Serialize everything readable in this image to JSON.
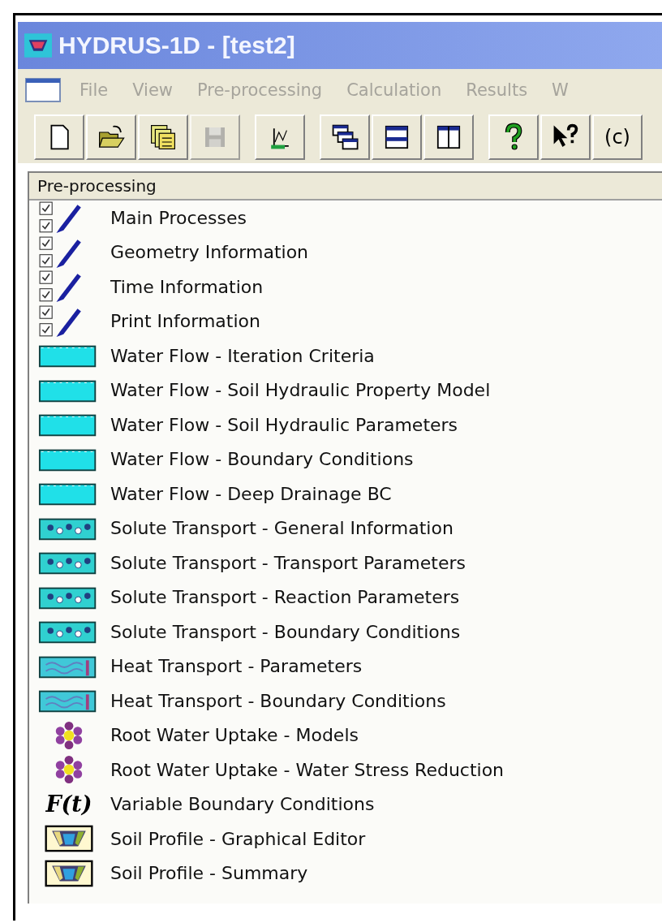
{
  "window": {
    "title": "HYDRUS-1D - [test2]"
  },
  "menu": [
    "File",
    "View",
    "Pre-processing",
    "Calculation",
    "Results",
    "W"
  ],
  "toolbar": [
    {
      "kind": "new",
      "disabled": false
    },
    {
      "kind": "open",
      "disabled": false
    },
    {
      "kind": "copy",
      "disabled": false
    },
    {
      "kind": "save",
      "disabled": true
    },
    {
      "kind": "graph",
      "disabled": false
    },
    {
      "kind": "cascade",
      "disabled": false
    },
    {
      "kind": "tile-horizontal",
      "disabled": false
    },
    {
      "kind": "tile-vertical",
      "disabled": false
    },
    {
      "kind": "help",
      "disabled": false
    },
    {
      "kind": "context-help",
      "disabled": false
    },
    {
      "kind": "text",
      "label": "(c)",
      "disabled": false
    }
  ],
  "panel": {
    "title": "Pre-processing",
    "items": [
      {
        "kind": "pencil",
        "label": "Main Processes"
      },
      {
        "kind": "pencil",
        "label": "Geometry Information"
      },
      {
        "kind": "pencil",
        "label": "Time Information"
      },
      {
        "kind": "pencil",
        "label": "Print Information"
      },
      {
        "kind": "water",
        "label": "Water Flow - Iteration Criteria"
      },
      {
        "kind": "water",
        "label": "Water Flow - Soil Hydraulic Property Model"
      },
      {
        "kind": "water",
        "label": "Water Flow - Soil Hydraulic Parameters"
      },
      {
        "kind": "water",
        "label": "Water Flow - Boundary Conditions"
      },
      {
        "kind": "water",
        "label": "Water Flow - Deep Drainage BC"
      },
      {
        "kind": "solute",
        "label": "Solute Transport - General Information"
      },
      {
        "kind": "solute",
        "label": "Solute Transport - Transport Parameters"
      },
      {
        "kind": "solute",
        "label": "Solute Transport - Reaction Parameters"
      },
      {
        "kind": "solute",
        "label": "Solute Transport - Boundary Conditions"
      },
      {
        "kind": "heat",
        "label": "Heat Transport - Parameters"
      },
      {
        "kind": "heat",
        "label": "Heat Transport - Boundary Conditions"
      },
      {
        "kind": "root",
        "label": "Root Water Uptake - Models"
      },
      {
        "kind": "root",
        "label": "Root Water Uptake - Water Stress Reduction"
      },
      {
        "kind": "function",
        "icon_text": "F(t)",
        "label": "Variable Boundary Conditions"
      },
      {
        "kind": "profile",
        "label": "Soil Profile - Graphical Editor"
      },
      {
        "kind": "profile",
        "label": "Soil Profile - Summary"
      }
    ]
  }
}
